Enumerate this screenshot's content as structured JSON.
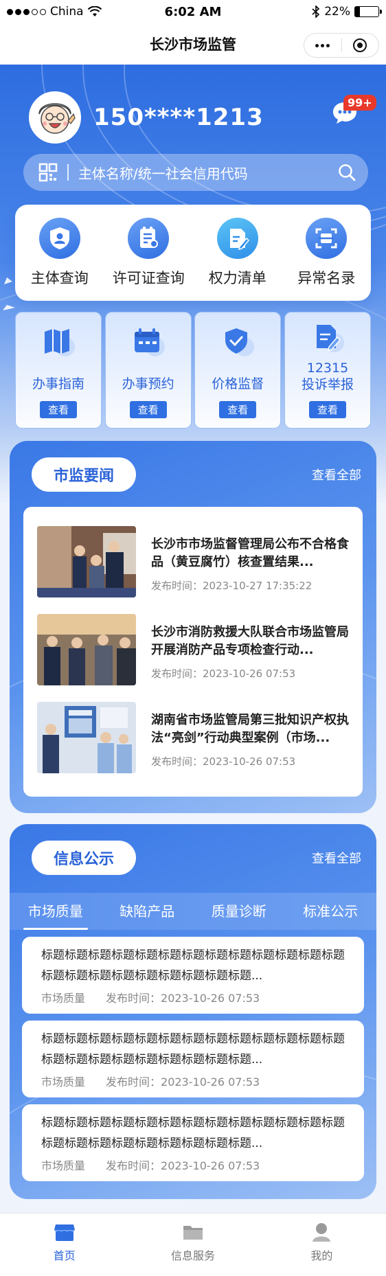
{
  "status_bar": {
    "carrier": "China",
    "time": "6:02 AM",
    "battery": "22%",
    "battery_level": 0.22
  },
  "nav": {
    "title": "长沙市场监管"
  },
  "user": {
    "phone": "150****1213",
    "message_badge": "99+"
  },
  "search": {
    "placeholder": "主体名称/统一社会信用代码"
  },
  "quick_actions": [
    {
      "label": "主体查询",
      "icon": "shield-user-icon"
    },
    {
      "label": "许可证查询",
      "icon": "license-search-icon"
    },
    {
      "label": "权力清单",
      "icon": "pencil-doc-icon"
    },
    {
      "label": "异常名录",
      "icon": "scan-frame-icon"
    }
  ],
  "services": [
    {
      "label": "办事指南",
      "button": "查看",
      "icon": "map-icon"
    },
    {
      "label": "办事预约",
      "button": "查看",
      "icon": "calendar-icon"
    },
    {
      "label": "价格监督",
      "button": "查看",
      "icon": "shield-check-icon"
    },
    {
      "label": "12315\n投诉举报",
      "line1": "12315",
      "line2": "投诉举报",
      "button": "查看",
      "icon": "complaint-doc-icon"
    }
  ],
  "news": {
    "title": "市监要闻",
    "more": "查看全部",
    "items": [
      {
        "title": "长沙市市场监督管理局公布不合格食品（黄豆腐竹）核查置结果...",
        "time": "发布时间：2023-10-27 17:35:22"
      },
      {
        "title": "长沙市消防救援大队联合市场监管局开展消防产品专项检查行动...",
        "time": "发布时间：2023-10-26 07:53"
      },
      {
        "title": "湖南省市场监管局第三批知识产权执法“亮剑”行动典型案例（市场...",
        "time": "发布时间：2023-10-26 07:53"
      }
    ]
  },
  "info": {
    "title": "信息公示",
    "more": "查看全部",
    "tabs": [
      "市场质量",
      "缺陷产品",
      "质量诊断",
      "标准公示"
    ],
    "items": [
      {
        "title": "标题标题标题标题标题标题标题标题标题标题标题标题标题标题标题标题标题标题标题标题标题标题...",
        "category": "市场质量",
        "time": "发布时间：2023-10-26 07:53"
      },
      {
        "title": "标题标题标题标题标题标题标题标题标题标题标题标题标题标题标题标题标题标题标题标题标题标题...",
        "category": "市场质量",
        "time": "发布时间：2023-10-26 07:53"
      },
      {
        "title": "标题标题标题标题标题标题标题标题标题标题标题标题标题标题标题标题标题标题标题标题标题标题...",
        "category": "市场质量",
        "time": "发布时间：2023-10-26 07:53"
      }
    ]
  },
  "tabbar": [
    {
      "label": "首页",
      "active": true
    },
    {
      "label": "信息服务",
      "active": false
    },
    {
      "label": "我的",
      "active": false
    }
  ],
  "colors": {
    "primary": "#2f6fe2",
    "accent_text": "#2a62d8",
    "badge": "#e8392b"
  }
}
